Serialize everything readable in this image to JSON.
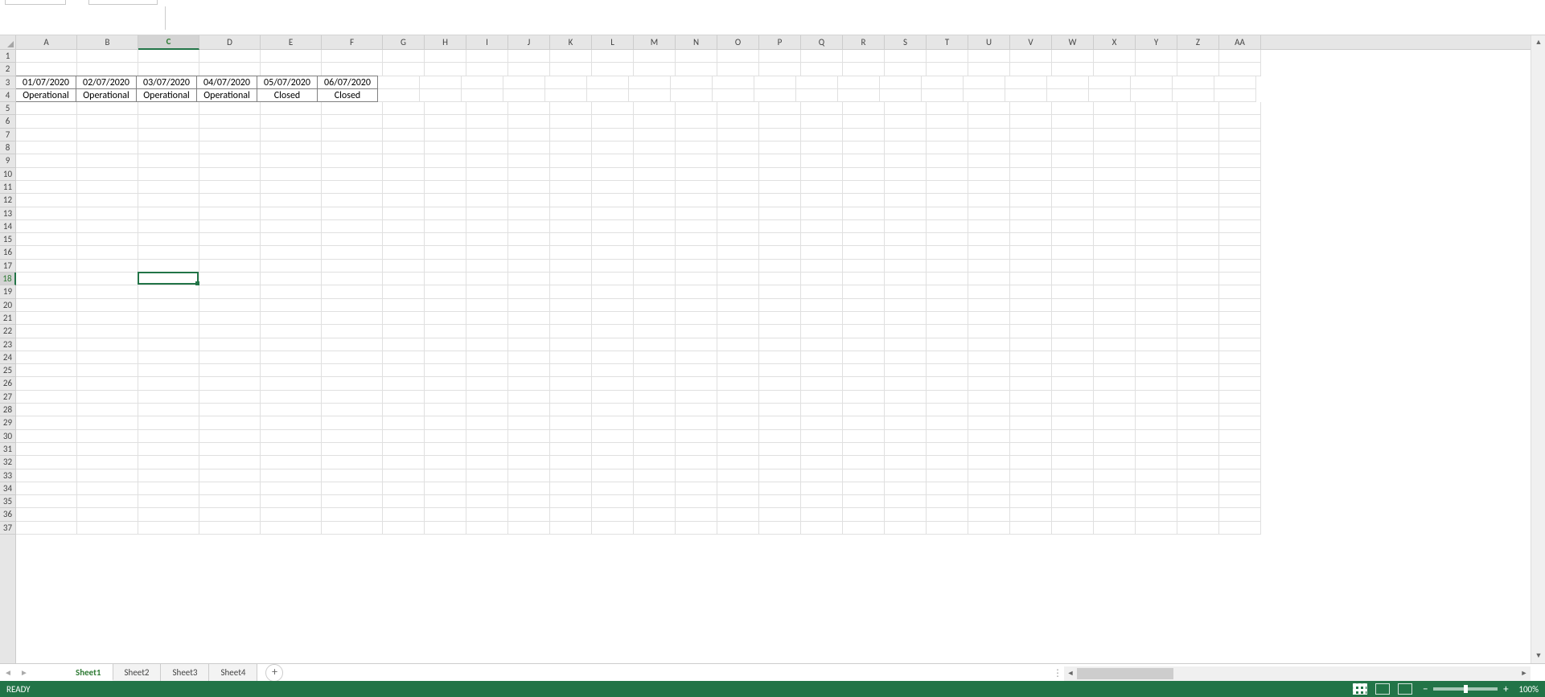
{
  "columns": [
    "A",
    "B",
    "C",
    "D",
    "E",
    "F",
    "G",
    "H",
    "I",
    "J",
    "K",
    "L",
    "M",
    "N",
    "O",
    "P",
    "Q",
    "R",
    "S",
    "T",
    "U",
    "V",
    "W",
    "X",
    "Y",
    "Z",
    "AA"
  ],
  "dataColWidth": 76,
  "restColWidth": 52,
  "nDataCols": 6,
  "activeCol": "C",
  "activeRow": 18,
  "rows": 37,
  "dataRows": {
    "3": [
      "01/07/2020",
      "02/07/2020",
      "03/07/2020",
      "04/07/2020",
      "05/07/2020",
      "06/07/2020"
    ],
    "4": [
      "Operational",
      "Operational",
      "Operational",
      "Operational",
      "Closed",
      "Closed"
    ]
  },
  "sheets": [
    "Sheet1",
    "Sheet2",
    "Sheet3",
    "Sheet4"
  ],
  "activeSheet": "Sheet1",
  "status": "READY",
  "zoom": "100%"
}
